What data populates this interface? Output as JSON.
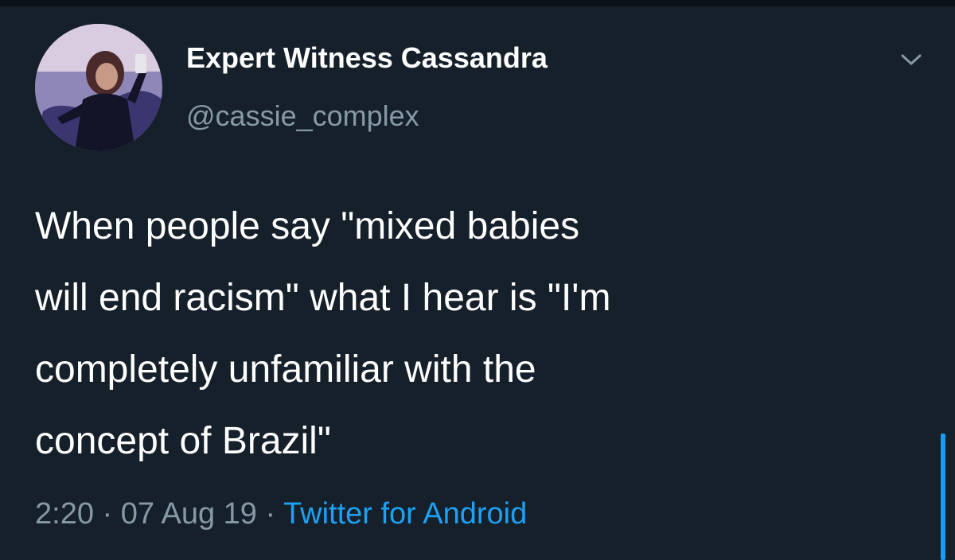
{
  "tweet": {
    "display_name": "Expert Witness Cassandra",
    "handle": "@cassie_complex",
    "text": "When people say \"mixed babies\nwill end racism\" what I hear is \"I'm\ncompletely unfamiliar with the\nconcept of Brazil\"",
    "time": "2:20",
    "separator": " · ",
    "date": "07 Aug 19",
    "source": "Twitter for Android"
  },
  "icons": {
    "avatar": "profile-photo",
    "menu": "chevron-down-icon"
  },
  "colors": {
    "background": "#15202b",
    "secondary_text": "#8899a6",
    "link": "#1da1f2"
  }
}
